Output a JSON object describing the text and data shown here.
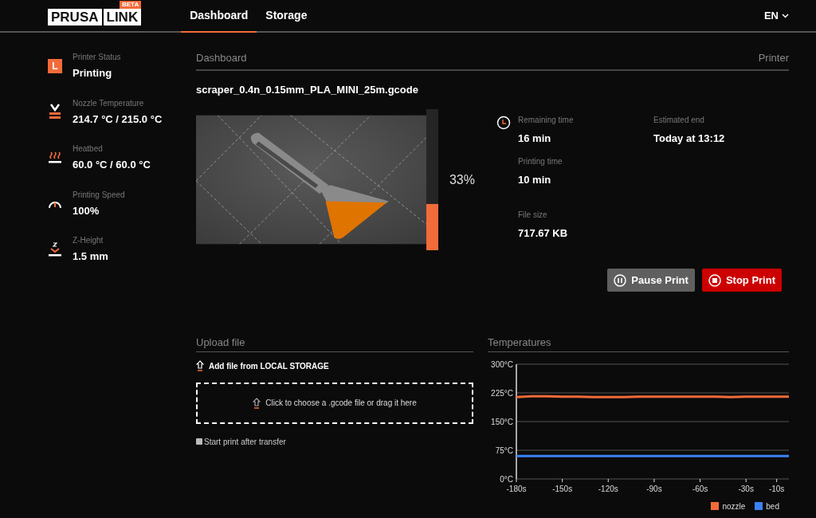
{
  "header": {
    "logo": {
      "left": "PRUSA",
      "right": "LINK",
      "badge": "BETA"
    },
    "tabs": [
      {
        "label": "Dashboard",
        "selected": true
      },
      {
        "label": "Storage",
        "selected": false
      }
    ],
    "language": "EN"
  },
  "sidebar": {
    "items": [
      {
        "kind": "status",
        "icon_letter": "L",
        "label": "Printer Status",
        "value": "Printing"
      },
      {
        "kind": "nozzle",
        "label": "Nozzle Temperature",
        "value": "214.7 °C / 215.0 °C"
      },
      {
        "kind": "heatbed",
        "label": "Heatbed",
        "value": "60.0 °C / 60.0 °C"
      },
      {
        "kind": "speed",
        "label": "Printing Speed",
        "value": "100%"
      },
      {
        "kind": "z",
        "label": "Z-Height",
        "value": "1.5 mm"
      }
    ]
  },
  "dashboard": {
    "title": "Dashboard",
    "right_title": "Printer",
    "file_name": "scraper_0.4n_0.15mm_PLA_MINI_25m.gcode",
    "progress": {
      "level": 0.33,
      "percent": "33%"
    },
    "info": [
      {
        "label": "Remaining time",
        "value": "16 min"
      },
      {
        "label": "Estimated end",
        "value": "Today at 13:12"
      },
      {
        "label": "Printing time",
        "value": "10 min"
      },
      {
        "label": "File size",
        "value": "717.67 KB"
      }
    ],
    "buttons": [
      {
        "kind": "pause",
        "label": "Pause Print"
      },
      {
        "kind": "stop",
        "label": "Stop Print"
      }
    ]
  },
  "upload": {
    "title": "Upload file",
    "add_label": "Add file from LOCAL STORAGE",
    "drop_text": "Click to choose a .gcode file or drag it here",
    "start_after": {
      "label": "Start print after transfer",
      "checked": false
    }
  },
  "temperatures": {
    "title": "Temperatures",
    "chart_data": {
      "type": "line",
      "x": [
        -180,
        -170,
        -160,
        -150,
        -140,
        -130,
        -120,
        -110,
        -100,
        -90,
        -80,
        -70,
        -60,
        -50,
        -40,
        -30,
        -20,
        -10,
        -2
      ],
      "series": [
        {
          "name": "nozzle",
          "color": "#f26b3a",
          "values": [
            214,
            216,
            216,
            215,
            215,
            214,
            214,
            214,
            215,
            215,
            215,
            215,
            215,
            215,
            214,
            215,
            215,
            215,
            215
          ]
        },
        {
          "name": "bed",
          "color": "#3b82f6",
          "values": [
            60,
            60,
            60,
            60,
            60,
            60,
            60,
            60,
            60,
            60,
            60,
            60,
            60,
            60,
            60,
            60,
            60,
            60,
            60
          ]
        }
      ],
      "xlim": [
        -180,
        -2
      ],
      "ylim": [
        0,
        300
      ],
      "grid": true,
      "legend": true,
      "xticks": [
        {
          "value": -180,
          "label": "-180s"
        },
        {
          "value": -150,
          "label": "-150s"
        },
        {
          "value": -120,
          "label": "-120s"
        },
        {
          "value": -90,
          "label": "-90s"
        },
        {
          "value": -60,
          "label": "-60s"
        },
        {
          "value": -30,
          "label": "-30s"
        },
        {
          "value": -10,
          "label": "-10s"
        }
      ],
      "yticks": [
        {
          "value": 0,
          "label": "0°C"
        },
        {
          "value": 75,
          "label": "75°C"
        },
        {
          "value": 150,
          "label": "150°C"
        },
        {
          "value": 225,
          "label": "225°C"
        },
        {
          "value": 300,
          "label": "300°C"
        }
      ]
    }
  }
}
